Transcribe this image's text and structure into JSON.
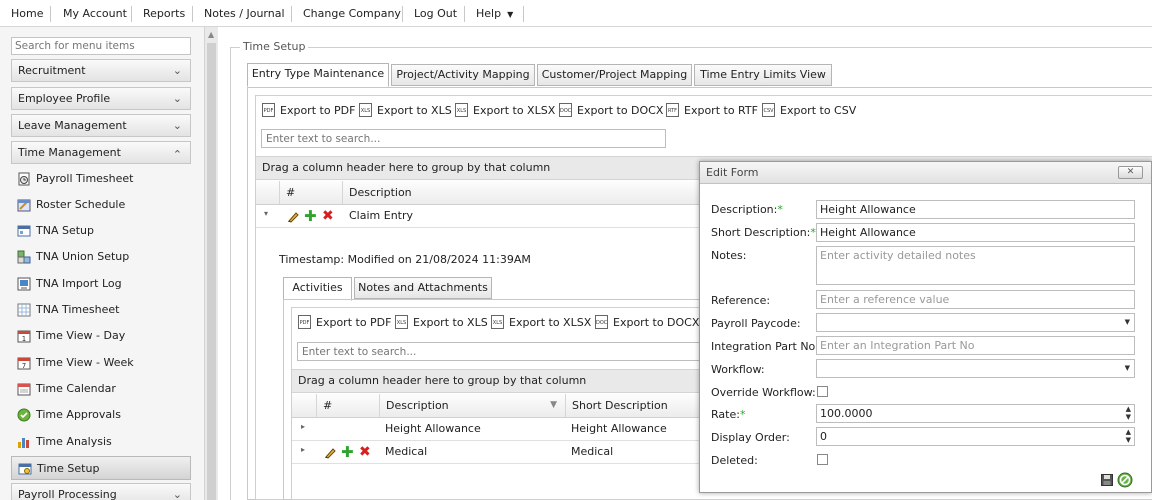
{
  "topmenu": {
    "items": [
      "Home",
      "My Account",
      "Reports",
      "Notes / Journal",
      "Change Company",
      "Log Out",
      "Help"
    ]
  },
  "sidebar": {
    "search_placeholder": "Search for menu items",
    "sections": [
      "Recruitment",
      "Employee Profile",
      "Leave Management",
      "Time Management"
    ],
    "items": [
      {
        "label": "Payroll Timesheet",
        "icon": "clock-sheet-icon"
      },
      {
        "label": "Roster Schedule",
        "icon": "roster-icon"
      },
      {
        "label": "TNA Setup",
        "icon": "tna-setup-icon"
      },
      {
        "label": "TNA Union Setup",
        "icon": "union-icon"
      },
      {
        "label": "TNA Import Log",
        "icon": "import-log-icon"
      },
      {
        "label": "TNA Timesheet",
        "icon": "timesheet-icon"
      },
      {
        "label": "Time View - Day",
        "icon": "calendar-day-icon"
      },
      {
        "label": "Time View - Week",
        "icon": "calendar-week-icon"
      },
      {
        "label": "Time Calendar",
        "icon": "calendar-icon"
      },
      {
        "label": "Time Approvals",
        "icon": "check-circle-icon"
      },
      {
        "label": "Time Analysis",
        "icon": "bar-chart-icon"
      },
      {
        "label": "Time Setup",
        "icon": "time-setup-icon"
      }
    ],
    "last_section": "Payroll Processing"
  },
  "main": {
    "legend": "Time Setup",
    "tabs": [
      "Entry Type Maintenance",
      "Project/Activity Mapping",
      "Customer/Project Mapping",
      "Time Entry Limits View"
    ],
    "exports": [
      "Export to PDF",
      "Export to XLS",
      "Export to XLSX",
      "Export to DOCX",
      "Export to RTF",
      "Export to CSV"
    ],
    "search_placeholder": "Enter text to search...",
    "group_hint": "Drag a column header here to group by that column",
    "columns": [
      "#",
      "Description"
    ],
    "row_description": "Claim Entry",
    "timestamp": "Timestamp: Modified on 21/08/2024 11:39AM",
    "subtabs": [
      "Activities",
      "Notes and Attachments"
    ],
    "sub_exports": [
      "Export to PDF",
      "Export to XLS",
      "Export to XLSX",
      "Export to DOCX"
    ],
    "sub_columns": [
      "#",
      "Description",
      "Short Description"
    ],
    "sub_rows": [
      {
        "description": "Height Allowance",
        "short": "Height Allowance"
      },
      {
        "description": "Medical",
        "short": "Medical"
      }
    ]
  },
  "form": {
    "title": "Edit Form",
    "close": "✕",
    "labels": {
      "description": "Description:",
      "short": "Short Description:",
      "notes": "Notes:",
      "reference": "Reference:",
      "paycode": "Payroll Paycode:",
      "integration": "Integration Part No:",
      "workflow": "Workflow:",
      "override": "Override Workflow:",
      "rate": "Rate:",
      "order": "Display Order:",
      "deleted": "Deleted:"
    },
    "required_mark": "*",
    "values": {
      "description": "Height Allowance",
      "short": "Height Allowance",
      "rate": "100.0000",
      "order": "0"
    },
    "placeholders": {
      "notes": "Enter activity detailed notes",
      "reference": "Enter a reference value",
      "integration": "Enter an Integration Part No"
    },
    "override_checked": false,
    "deleted_checked": false
  }
}
